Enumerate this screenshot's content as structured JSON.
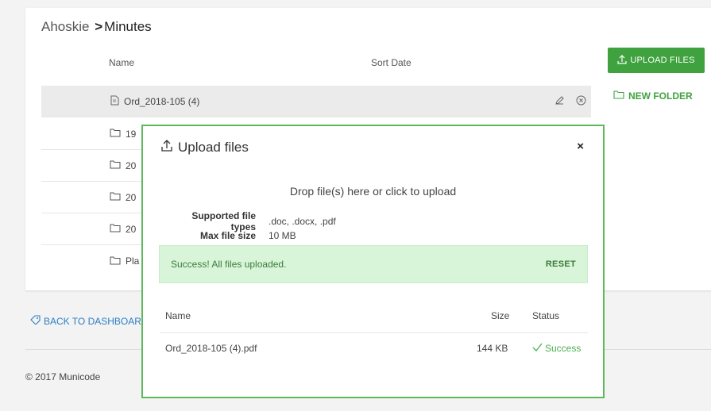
{
  "breadcrumb": {
    "parent": "Ahoskie",
    "separator": ">",
    "current": "Minutes"
  },
  "table": {
    "col_name": "Name",
    "col_sort_date": "Sort Date",
    "rows": [
      {
        "label": "Ord_2018-105 (4)",
        "icon": "pdf-file-icon"
      },
      {
        "label": "19",
        "icon": "folder-icon"
      },
      {
        "label": "20",
        "icon": "folder-icon"
      },
      {
        "label": "20",
        "icon": "folder-icon"
      },
      {
        "label": "20",
        "icon": "folder-icon"
      },
      {
        "label": "Pla",
        "icon": "folder-icon"
      }
    ]
  },
  "actions": {
    "upload_label": "UPLOAD FILES",
    "new_folder_label": "NEW FOLDER"
  },
  "back_link": "BACK TO DASHBOARD",
  "footer": "© 2017 Municode",
  "modal": {
    "title": "Upload files",
    "close": "×",
    "drop_text": "Drop file(s) here or click to upload",
    "supported_label": "Supported file types",
    "supported_value": ".doc, .docx, .pdf",
    "max_label": "Max file size",
    "max_value": "10 MB",
    "alert_text": "Success! All files uploaded.",
    "reset_label": "RESET",
    "file_table": {
      "col_name": "Name",
      "col_size": "Size",
      "col_status": "Status",
      "rows": [
        {
          "name": "Ord_2018-105 (4).pdf",
          "size": "144 KB",
          "status": "Success"
        }
      ]
    }
  },
  "colors": {
    "accent_green": "#3fa23f",
    "link_blue": "#2b7fc6",
    "alert_bg": "#d9f5d9"
  }
}
